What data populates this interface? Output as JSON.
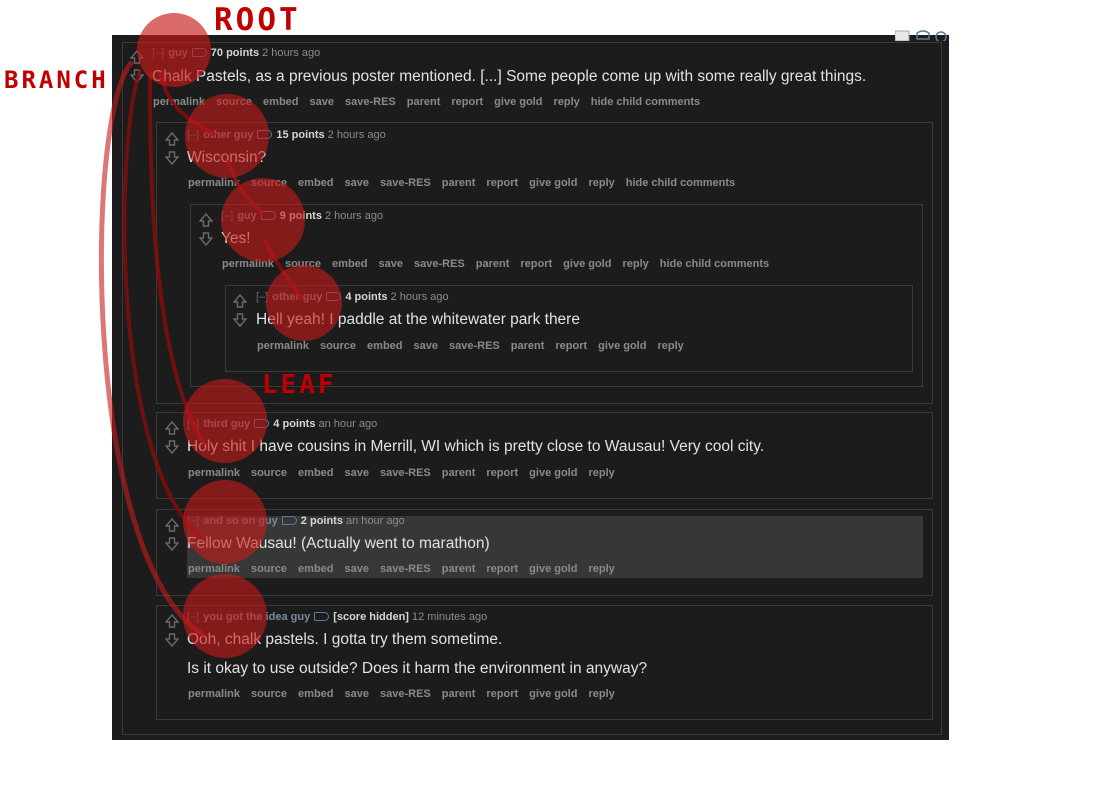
{
  "annotations": {
    "root": "ROOT",
    "branch": "BRANCH",
    "leaf": "LEAF"
  },
  "colors": {
    "panel": "#1c1c1c",
    "annotation": "#c00000",
    "circle_fill": "#c81a1a",
    "author": "#7a8aa0",
    "highlight_row": "#373737"
  },
  "comments": [
    {
      "collapse": "[–]",
      "author": "guy",
      "score": "70 points",
      "time": "2 hours ago",
      "body": [
        "Chalk Pastels, as a previous poster mentioned. [...] Some people come up with some really great things."
      ],
      "buttons": [
        "permalink",
        "source",
        "embed",
        "save",
        "save-RES",
        "parent",
        "report",
        "give gold",
        "reply",
        "hide child comments"
      ]
    },
    {
      "collapse": "[–]",
      "author": "other guy",
      "score": "15 points",
      "time": "2 hours ago",
      "body": [
        "Wisconsin?"
      ],
      "buttons": [
        "permalink",
        "source",
        "embed",
        "save",
        "save-RES",
        "parent",
        "report",
        "give gold",
        "reply",
        "hide child comments"
      ]
    },
    {
      "collapse": "[–]",
      "author": "guy",
      "score": "9 points",
      "time": "2 hours ago",
      "body": [
        "Yes!"
      ],
      "buttons": [
        "permalink",
        "source",
        "embed",
        "save",
        "save-RES",
        "parent",
        "report",
        "give gold",
        "reply",
        "hide child comments"
      ]
    },
    {
      "collapse": "[–]",
      "author": "other guy",
      "score": "4 points",
      "time": "2 hours ago",
      "body": [
        "Hell yeah! I paddle at the whitewater park there"
      ],
      "buttons": [
        "permalink",
        "source",
        "embed",
        "save",
        "save-RES",
        "parent",
        "report",
        "give gold",
        "reply"
      ]
    },
    {
      "collapse": "[–]",
      "author": "third guy",
      "score": "4 points",
      "time": "an hour ago",
      "body": [
        "Holy shit I have cousins in Merrill, WI which is pretty close to Wausau! Very cool city."
      ],
      "buttons": [
        "permalink",
        "source",
        "embed",
        "save",
        "save-RES",
        "parent",
        "report",
        "give gold",
        "reply"
      ]
    },
    {
      "collapse": "[–]",
      "author": "and so on guy",
      "score": "2 points",
      "time": "an hour ago",
      "body": [
        "Fellow Wausau! (Actually went to marathon)"
      ],
      "buttons": [
        "permalink",
        "source",
        "embed",
        "save",
        "save-RES",
        "parent",
        "report",
        "give gold",
        "reply"
      ]
    },
    {
      "collapse": "[–]",
      "author": "you got the idea guy",
      "score": "[score hidden]",
      "time": "12 minutes ago",
      "body": [
        "Ooh, chalk pastels. I gotta try them sometime.",
        "Is it okay to use outside? Does it harm the environment in anyway?"
      ],
      "buttons": [
        "permalink",
        "source",
        "embed",
        "save",
        "save-RES",
        "parent",
        "report",
        "give gold",
        "reply"
      ]
    }
  ]
}
